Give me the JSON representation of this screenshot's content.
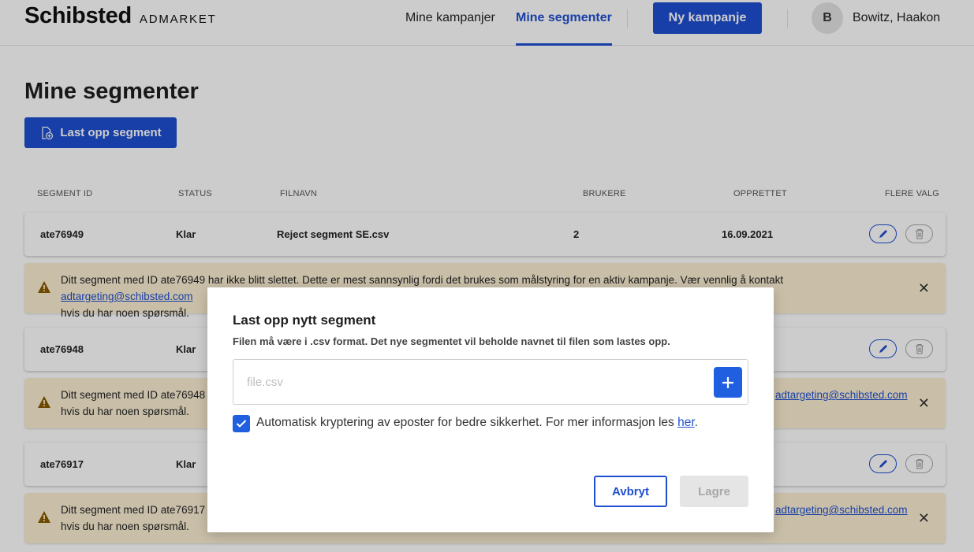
{
  "header": {
    "logo_main": "Schibsted",
    "logo_sub": "ADMARKET",
    "nav": [
      "Mine kampanjer",
      "Mine segmenter"
    ],
    "new_campaign": "Ny kampanje",
    "avatar_initial": "B",
    "user_name": "Bowitz, Haakon"
  },
  "page": {
    "title": "Mine segmenter",
    "upload_button": "Last opp segment"
  },
  "table": {
    "columns": [
      "SEGMENT ID",
      "STATUS",
      "FILNAVN",
      "BRUKERE",
      "OPPRETTET",
      "FLERE VALG"
    ],
    "rows": [
      {
        "id": "ate76949",
        "status": "Klar",
        "filename": "Reject segment SE.csv",
        "users": "2",
        "created": "16.09.2021"
      },
      {
        "id": "ate76948",
        "status": "Klar",
        "filename": "",
        "users": "",
        "created": ""
      },
      {
        "id": "ate76917",
        "status": "Klar",
        "filename": "",
        "users": "",
        "created": ""
      }
    ],
    "warnings": [
      {
        "text": "Ditt segment med ID ate76949 har ikke blitt slettet. Dette er mest sannsynlig fordi det brukes som målstyring for en aktiv kampanje. Vær vennlig å kontakt ",
        "link": "adtargeting@schibsted.com",
        "text2": "hvis du har noen spørsmål."
      },
      {
        "text": "Ditt segment med ID ate76948 h",
        "link": "adtargeting@schibsted.com",
        "text2": "hvis du har noen spørsmål."
      },
      {
        "text": "Ditt segment med ID ate76917 h",
        "link": "adtargeting@schibsted.com",
        "text2": "hvis du har noen spørsmål."
      }
    ]
  },
  "modal": {
    "title": "Last opp nytt segment",
    "subtitle": "Filen må være i .csv format. Det nye segmentet vil beholde navnet til filen som lastes opp.",
    "file_placeholder": "file.csv",
    "checkbox_label": "Automatisk kryptering av eposter for bedre sikkerhet. For mer informasjon les ",
    "checkbox_link": "her",
    "checkbox_end": ".",
    "checked": true,
    "cancel": "Avbryt",
    "save": "Lagre"
  },
  "colors": {
    "primary": "#1f4fd1",
    "warning_bg": "#fcefd4",
    "warning_icon": "#8a5a00"
  },
  "icons": [
    "file-add-icon",
    "edit-icon",
    "trash-icon",
    "warning-icon",
    "close-icon",
    "plus-icon",
    "check-icon"
  ]
}
